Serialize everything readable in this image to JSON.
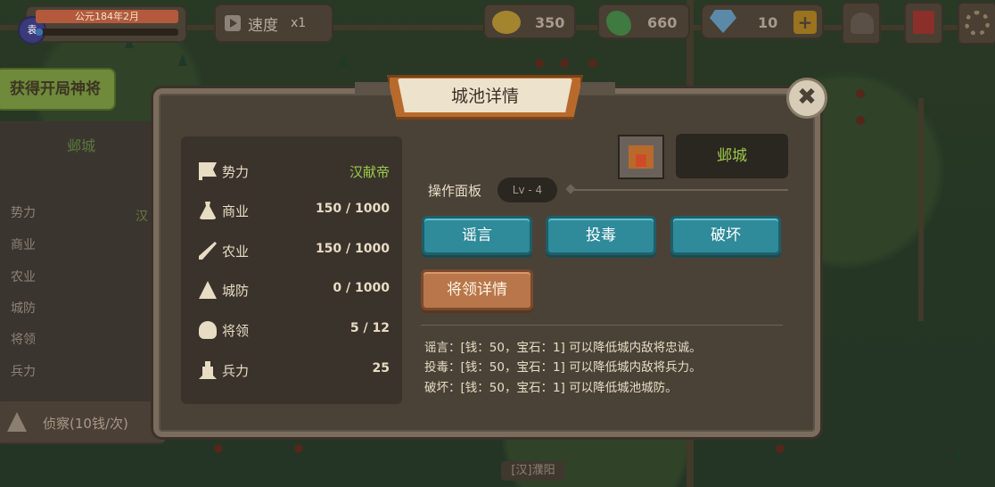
{
  "hud": {
    "date": "公元184年2月",
    "date_progress": 0.05,
    "avatar_text": "袁",
    "speed_label": "速度",
    "speed_value": "x1",
    "gold": "350",
    "food": "660",
    "gems": "10",
    "plus": "+"
  },
  "get_general_label": "获得开局神将",
  "side_panel": {
    "title": "邺城",
    "rows": [
      "势力",
      "商业",
      "农业",
      "城防",
      "将领",
      "兵力"
    ],
    "faction_partial": "汉",
    "scout_label": "侦察(10钱/次)"
  },
  "map_label": "[汉]濮阳",
  "dialog": {
    "title": "城池详情",
    "close": "✖",
    "city_name": "邺城",
    "stats": [
      {
        "label": "势力",
        "value": "汉献帝"
      },
      {
        "label": "商业",
        "value": "150 / 1000"
      },
      {
        "label": "农业",
        "value": "150 / 1000"
      },
      {
        "label": "城防",
        "value": "0 / 1000"
      },
      {
        "label": "将领",
        "value": "5 / 12"
      },
      {
        "label": "兵力",
        "value": "25"
      }
    ],
    "op_panel_label": "操作面板",
    "level": "Lv - 4",
    "actions": [
      "谣言",
      "投毒",
      "破坏"
    ],
    "general_detail": "将领详情",
    "descriptions": [
      "谣言：[钱：50，宝石：1] 可以降低城内敌将忠诚。",
      "投毒：[钱：50，宝石：1] 可以降低城内敌将兵力。",
      "破坏：[钱：50，宝石：1] 可以降低城池城防。"
    ]
  }
}
